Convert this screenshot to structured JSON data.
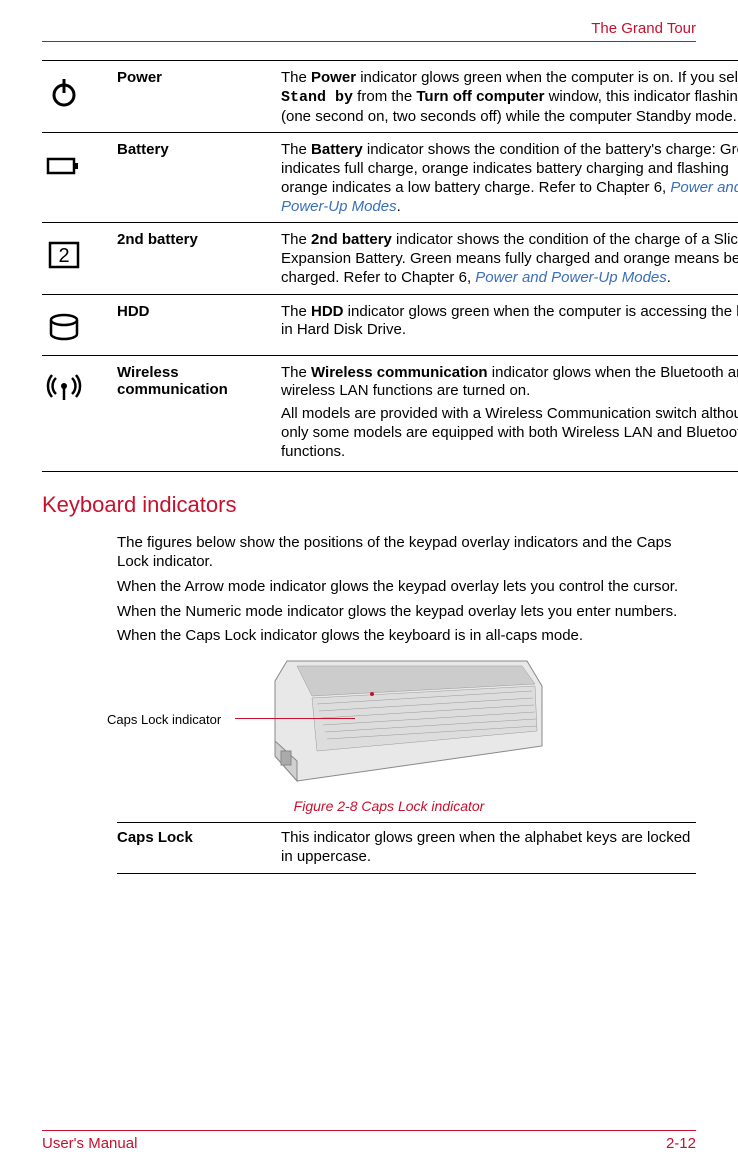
{
  "header": {
    "chapter_title": "The Grand Tour"
  },
  "indicators": {
    "power": {
      "label": "Power",
      "desc_prefix": "The ",
      "desc_bold1": "Power",
      "desc_mid1": " indicator glows green when the computer is on. If you select ",
      "desc_mono": "Stand by",
      "desc_mid2": " from the ",
      "desc_bold2": "Turn off computer",
      "desc_suffix": " window, this indicator flashing (one second on, two seconds off) while the computer Standby mode."
    },
    "battery": {
      "label": "Battery",
      "desc_prefix": "The ",
      "desc_bold1": "Battery",
      "desc_mid": " indicator shows the condition of the battery's charge: Green indicates full charge, orange indicates battery charging and flashing orange indicates a low battery charge. Refer to Chapter 6, ",
      "desc_link": "Power and Power-Up Modes",
      "desc_suffix": "."
    },
    "battery2": {
      "label": "2nd battery",
      "desc_prefix": "The ",
      "desc_bold1": "2nd battery",
      "desc_mid": " indicator shows the condition of the charge of a Slice Expansion Battery. Green means fully charged and orange means being charged. Refer to Chapter 6, ",
      "desc_link": "Power and Power-Up Modes",
      "desc_suffix": "."
    },
    "hdd": {
      "label": "HDD",
      "desc_prefix": "The ",
      "desc_bold1": "HDD",
      "desc_suffix": " indicator glows green when the computer is accessing the built-in Hard Disk Drive."
    },
    "wireless": {
      "label": "Wireless communication",
      "p1_prefix": "The ",
      "p1_bold": "Wireless communication",
      "p1_suffix": " indicator glows when the Bluetooth and wireless LAN functions are turned on.",
      "p2": "All models are provided with a Wireless Communication switch although only some models are equipped with both Wireless LAN and Bluetooth functions."
    }
  },
  "section": {
    "heading": "Keyboard indicators",
    "p1": "The figures below show the positions of the keypad overlay indicators and the Caps Lock indicator.",
    "p2": "When the Arrow mode indicator glows the keypad overlay lets you control the cursor.",
    "p3": "When the Numeric mode indicator glows the keypad overlay lets you enter numbers.",
    "p4": "When the Caps Lock indicator glows the keyboard is in all-caps mode."
  },
  "figure": {
    "label": "Caps Lock indicator",
    "caption": "Figure 2-8 Caps Lock indicator"
  },
  "capslock": {
    "label": "Caps Lock",
    "desc": "This indicator glows green when the alphabet keys are locked in uppercase."
  },
  "footer": {
    "left": "User's Manual",
    "right": "2-12"
  }
}
